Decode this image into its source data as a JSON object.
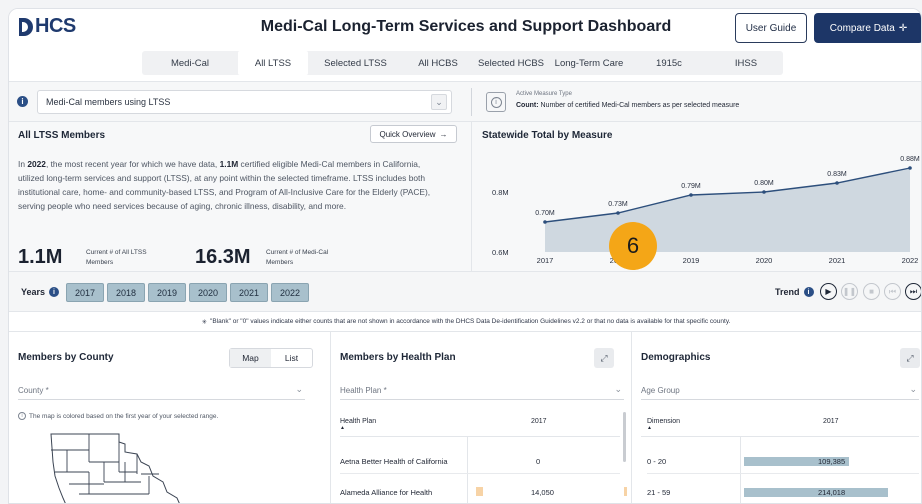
{
  "brand": {
    "logo": "HCS"
  },
  "header": {
    "title": "Medi-Cal Long-Term Services and Support Dashboard",
    "user_guide": "User Guide",
    "compare": "Compare Data"
  },
  "tabs": [
    {
      "label": "Medi-Cal"
    },
    {
      "label": "All LTSS"
    },
    {
      "label": "Selected LTSS"
    },
    {
      "label": "All HCBS"
    },
    {
      "label": "Selected HCBS"
    },
    {
      "label": "Long-Term Care"
    },
    {
      "label": "1915c"
    },
    {
      "label": "IHSS"
    }
  ],
  "filter": {
    "select_value": "Medi-Cal members using LTSS",
    "measure_type_label": "Active Measure Type",
    "measure_value_bold": "Count:",
    "measure_value_text": " Number of certified Medi-Cal members as per selected measure"
  },
  "summary": {
    "title": "All LTSS Members",
    "quick_overview": "Quick Overview",
    "p1": "In ",
    "p_year": "2022",
    "p2": ", the most recent year for which we have data, ",
    "p_count": "1.1M",
    "p3": " certified eligible Medi-Cal members in California, utilized long-term services and support (LTSS), at any point within the selected timeframe. LTSS includes both institutional care, home- and community-based LTSS, and Program of All-Inclusive Care for the Elderly (PACE), serving people who need services because of aging, chronic illness, disability, and more.",
    "stat1_value": "1.1M",
    "stat1_label": "Current # of All LTSS Members",
    "stat2_value": "16.3M",
    "stat2_label": "Current # of Medi-Cal Members"
  },
  "chart_data": {
    "type": "area",
    "title": "Statewide Total by Measure",
    "x": [
      "2017",
      "2018",
      "2019",
      "2020",
      "2021",
      "2022"
    ],
    "series": [
      {
        "values": [
          0.7,
          0.73,
          0.79,
          0.8,
          0.83,
          0.88
        ]
      }
    ],
    "data_labels": [
      "0.70M",
      "0.73M",
      "0.79M",
      "0.80M",
      "0.83M",
      "0.88M"
    ],
    "y_ticks": [
      "0.6M",
      "0.8M"
    ],
    "ylim": [
      0.6,
      0.9
    ],
    "grid": false,
    "fill_color": "#cfd8e0",
    "line_color": "#2d4f7c"
  },
  "badge": "6",
  "years": {
    "label": "Years",
    "items": [
      "2017",
      "2018",
      "2019",
      "2020",
      "2021",
      "2022"
    ],
    "trend_label": "Trend"
  },
  "note": "\"Blank\" or \"0\" values indicate either counts that are not shown in accordance with the DHCS Data De-identification Guidelines v2.2 or that no data is available for that specific county.",
  "county_panel": {
    "title": "Members by County",
    "toggle_map": "Map",
    "toggle_list": "List",
    "dropdown": "County *",
    "map_note": "The map is colored based on the first year of your selected range."
  },
  "plan_panel": {
    "title": "Members by Health Plan",
    "dropdown": "Health Plan *",
    "col_plan": "Health Plan",
    "col_year": "2017",
    "rows": [
      {
        "plan": "Aetna Better Health of California",
        "value": "0"
      },
      {
        "plan": "Alameda Alliance for Health",
        "value": "14,050"
      }
    ]
  },
  "demo_panel": {
    "title": "Demographics",
    "dropdown": "Age Group",
    "col_dim": "Dimension",
    "col_year": "2017",
    "rows": [
      {
        "dim": "0 - 20",
        "value": "109,385"
      },
      {
        "dim": "21 - 59",
        "value": "214,018"
      }
    ]
  }
}
